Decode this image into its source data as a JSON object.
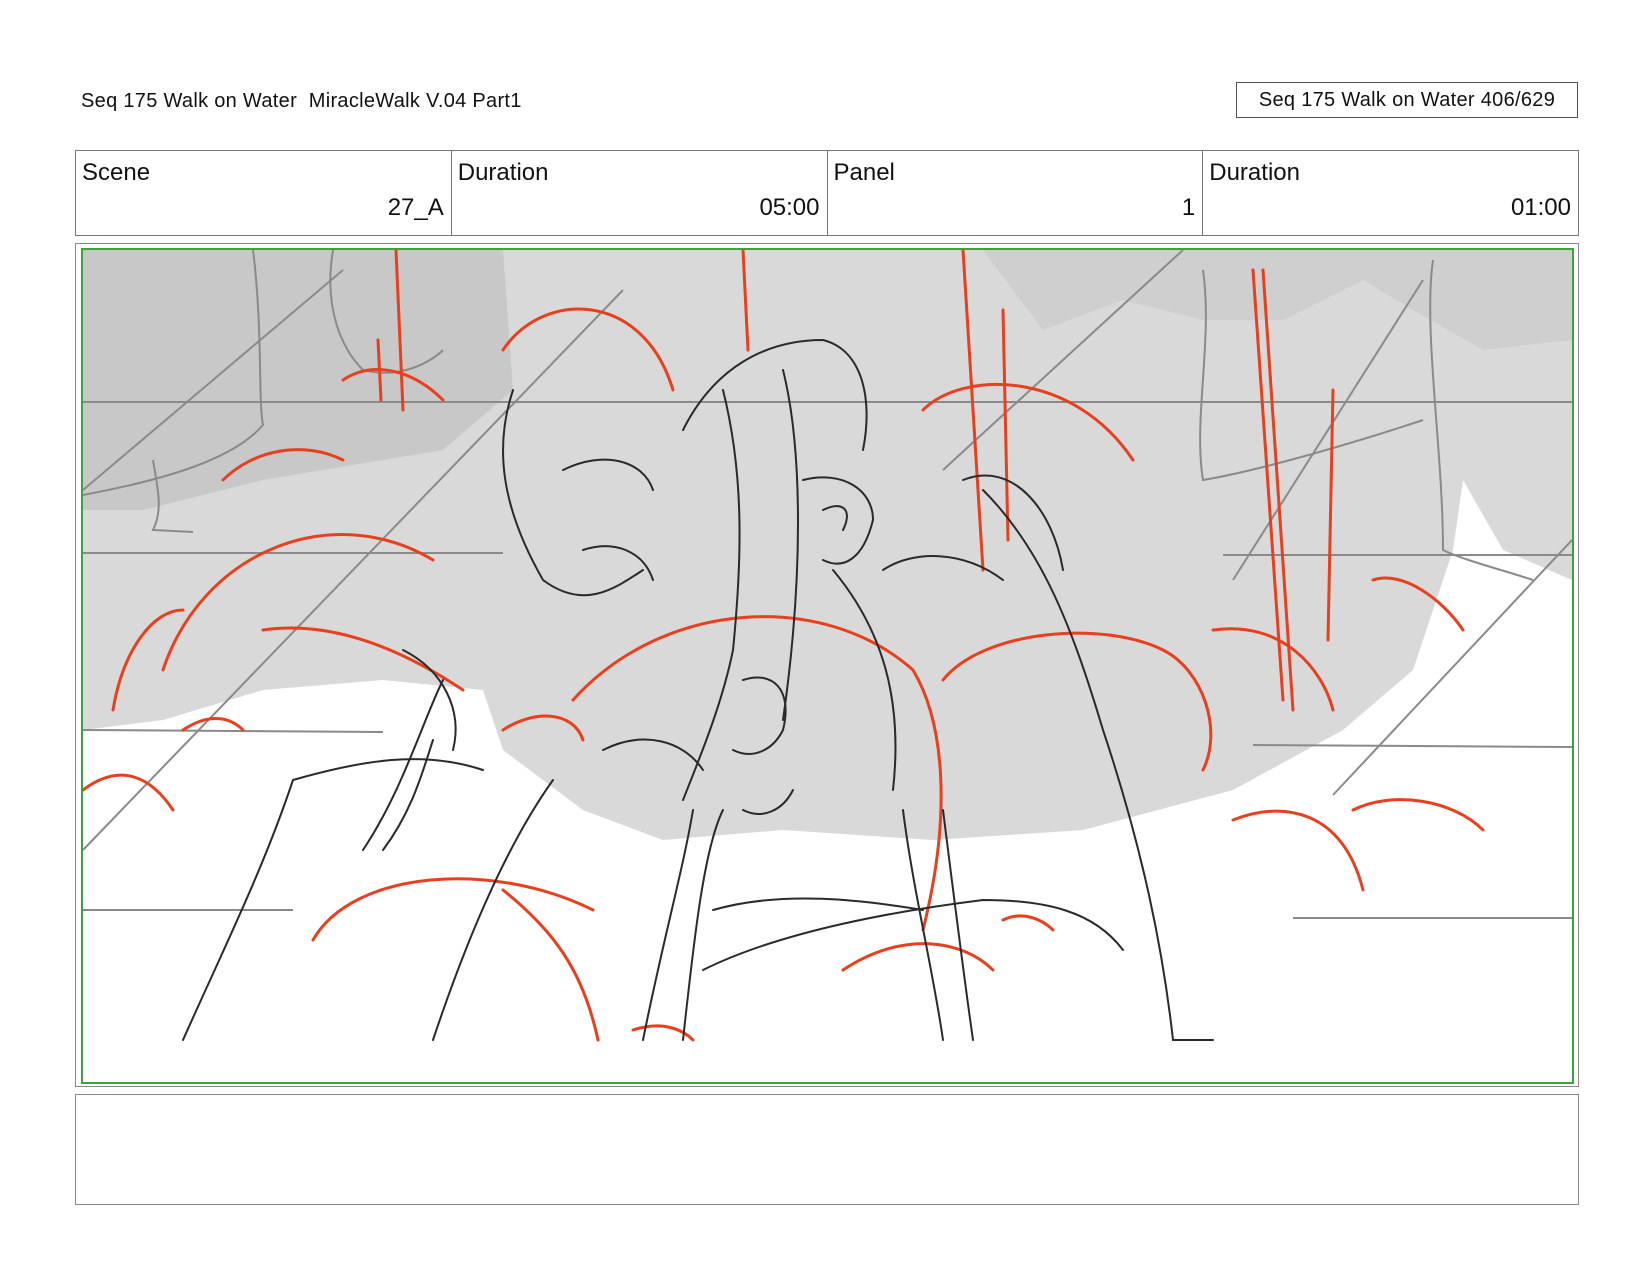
{
  "header": {
    "title": "Seq 175 Walk on Water  MiracleWalk V.04 Part1",
    "page_label": "Seq 175 Walk on Water 406/629"
  },
  "info": {
    "scene_label": "Scene",
    "scene_value": "27_A",
    "duration_label": "Duration",
    "duration_value": "05:00",
    "panel_label": "Panel",
    "panel_value": "1",
    "panel_duration_label": "Duration",
    "panel_duration_value": "01:00"
  },
  "notes": {
    "text": ""
  },
  "colors": {
    "frame_border": "#3aa53a",
    "sketch_red": "#e8401e",
    "sketch_gray": "#d6d6d6"
  }
}
